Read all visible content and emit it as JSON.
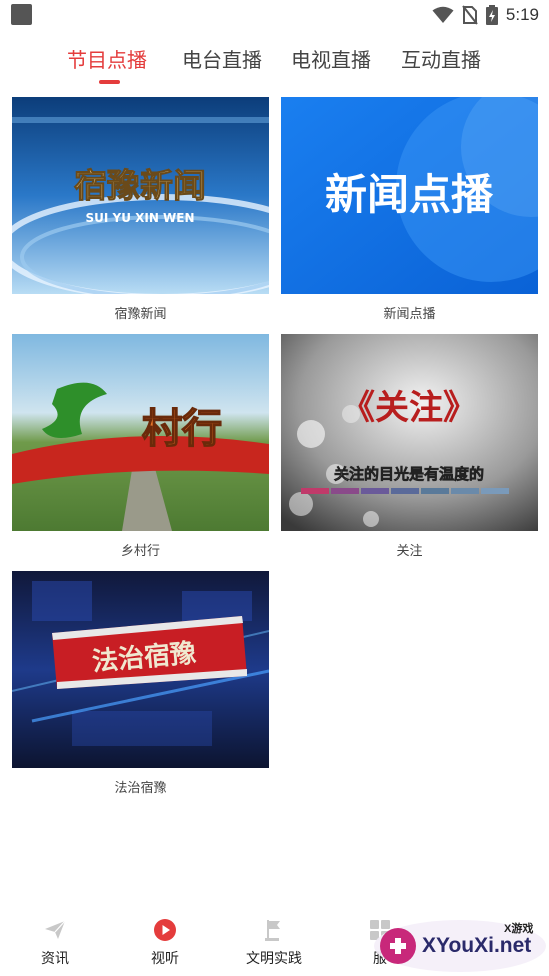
{
  "status": {
    "time": "5:19"
  },
  "tabs": [
    {
      "label": "节目点播",
      "active": true
    },
    {
      "label": "电台直播",
      "active": false
    },
    {
      "label": "电视直播",
      "active": false
    },
    {
      "label": "互动直播",
      "active": false
    }
  ],
  "programs": [
    {
      "label": "宿豫新闻",
      "thumb_title": "宿豫新闻",
      "thumb_subtitle": "SUI YU XIN WEN"
    },
    {
      "label": "新闻点播",
      "thumb_title": "新闻点播"
    },
    {
      "label": "乡村行",
      "thumb_title": "村行"
    },
    {
      "label": "关注",
      "thumb_title": "《关注》",
      "thumb_subtitle": "关注的目光是有温度的"
    },
    {
      "label": "法治宿豫",
      "thumb_title": "法治宿豫"
    }
  ],
  "bottom_nav": [
    {
      "label": "资讯",
      "icon": "paper-plane-icon"
    },
    {
      "label": "视听",
      "icon": "play-circle-icon",
      "active": true
    },
    {
      "label": "文明实践",
      "icon": "flag-icon"
    },
    {
      "label": "服",
      "icon": "grid-icon"
    }
  ],
  "watermark": {
    "text": "XYouXi.net",
    "small": "X游戏"
  },
  "colors": {
    "accent": "#e43c3c"
  }
}
